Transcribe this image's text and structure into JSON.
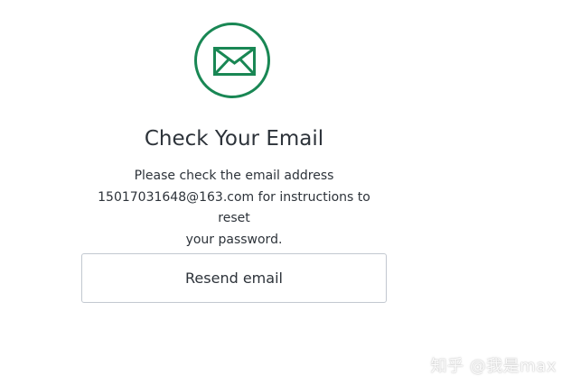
{
  "icons": {
    "envelope": "envelope-icon"
  },
  "colors": {
    "accent": "#198754",
    "text": "#2d333a",
    "button_border": "#c2c8d0"
  },
  "page": {
    "title": "Check Your Email",
    "message_line1": "Please check the email address",
    "message_line2": "15017031648@163.com for instructions to reset",
    "message_line3": "your password.",
    "resend_label": "Resend email"
  },
  "watermark": {
    "text": "知乎 @我是max"
  }
}
